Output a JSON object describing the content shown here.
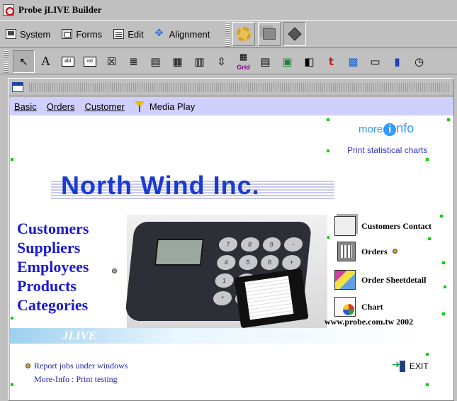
{
  "window": {
    "title": "Probe jLIVE Builder"
  },
  "menubar": {
    "items": [
      {
        "label": "System",
        "icon": "system-icon"
      },
      {
        "label": "Forms",
        "icon": "forms-icon"
      },
      {
        "label": "Edit",
        "icon": "edit-icon"
      },
      {
        "label": "Alignment",
        "icon": "alignment-icon"
      }
    ],
    "tool_buttons": [
      "gear-icon",
      "boxes-icon",
      "cube-icon"
    ]
  },
  "component_toolbar": {
    "tools": [
      {
        "icon": "pointer-icon",
        "glyph": "↖"
      },
      {
        "icon": "label-tool-icon",
        "glyph": "A"
      },
      {
        "icon": "textfield-tool-icon",
        "glyph": "abl"
      },
      {
        "icon": "textarea-tool-icon",
        "glyph": "xxl"
      },
      {
        "icon": "checkbox-tool-icon",
        "glyph": "☒"
      },
      {
        "icon": "list-tool-icon",
        "glyph": "≣"
      },
      {
        "icon": "combo-tool-icon",
        "glyph": "▤"
      },
      {
        "icon": "table-tool-icon",
        "glyph": "▦"
      },
      {
        "icon": "tree-tool-icon",
        "glyph": "▥"
      },
      {
        "icon": "scroll-tool-icon",
        "glyph": "⇳"
      },
      {
        "icon": "grid-tool-icon",
        "glyph": "Grid"
      },
      {
        "icon": "document-tool-icon",
        "glyph": "▤"
      },
      {
        "icon": "image-tool-icon",
        "glyph": "▣"
      },
      {
        "icon": "media-tool-icon",
        "glyph": "◧"
      },
      {
        "icon": "text-style-tool-icon",
        "glyph": "t"
      },
      {
        "icon": "picture-tool-icon",
        "glyph": "▩"
      },
      {
        "icon": "window-tool-icon",
        "glyph": "▭"
      },
      {
        "icon": "chart-tool-icon",
        "glyph": "▮"
      },
      {
        "icon": "timer-tool-icon",
        "glyph": "◷"
      }
    ]
  },
  "nav": {
    "items": [
      "Basic",
      "Orders",
      "Customer"
    ],
    "media": "Media Play"
  },
  "canvas": {
    "more_info": {
      "more": "more",
      "i": "i",
      "nfo": "nfo"
    },
    "print_statistical": "Print statistical charts",
    "brand": "North Wind Inc.",
    "left_menu": [
      "Customers",
      "Suppliers",
      "Employees",
      "Products",
      "Categories"
    ],
    "right_items": [
      {
        "label": "Customers Contact",
        "icon": "contact-icon"
      },
      {
        "label": "Orders",
        "icon": "orders-icon"
      },
      {
        "label": "Order Sheetdetail",
        "icon": "sheet-icon"
      },
      {
        "label": "Chart",
        "icon": "chart-icon"
      }
    ],
    "www": "www.probe.com.tw  2002",
    "jlive": "JLIVE",
    "report_link": "Report jobs under windows",
    "more_print": "More-Info : Print testing",
    "exit": "EXIT"
  },
  "colors": {
    "nav_bg": "#d0d0ff",
    "brand": "#1a3ad0",
    "menu_link": "#1a1ad0",
    "handle": "#00d000"
  }
}
